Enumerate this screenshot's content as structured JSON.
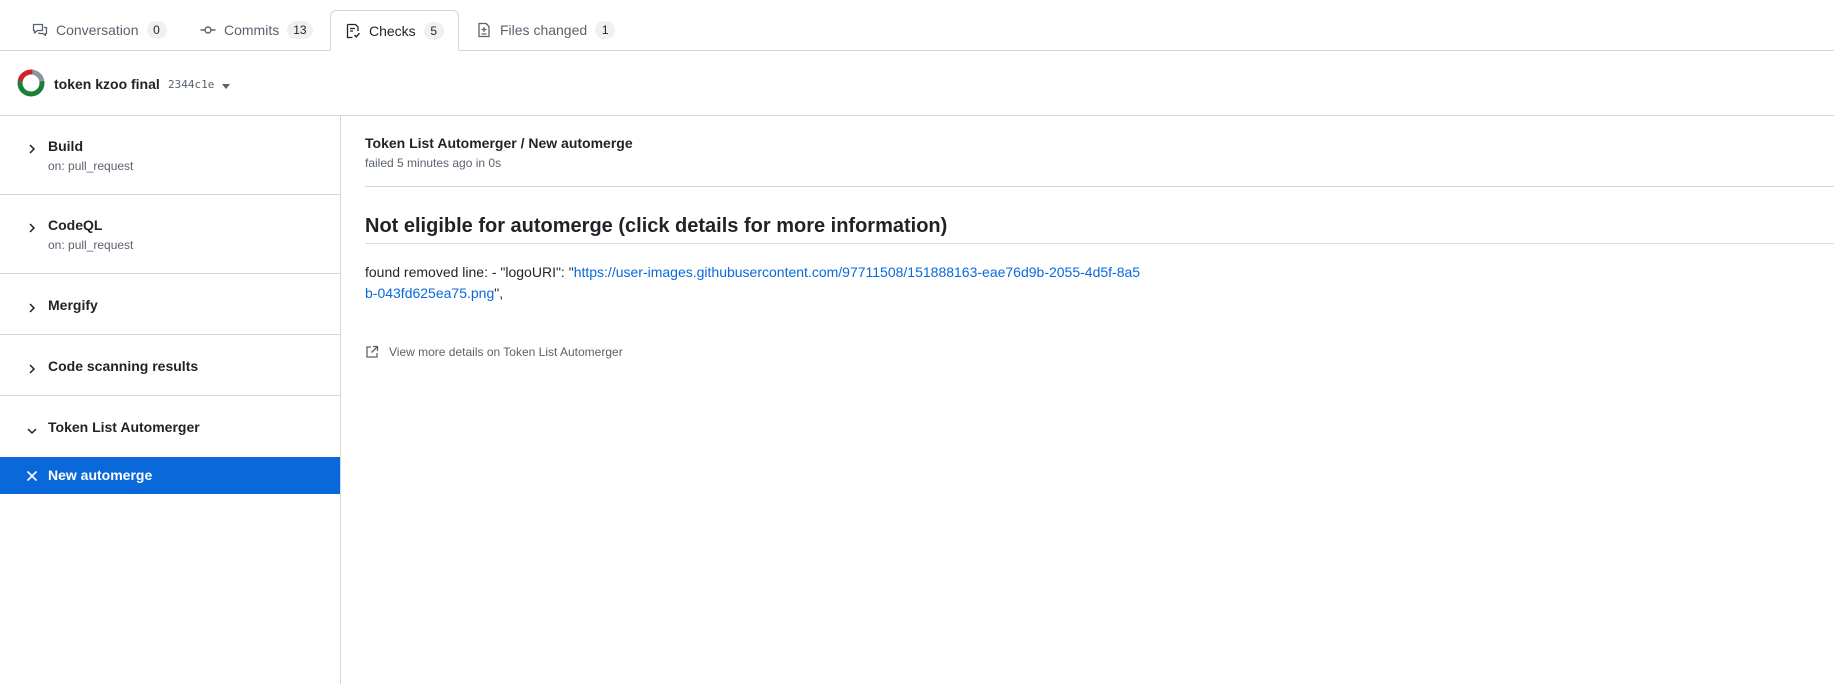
{
  "tabs": [
    {
      "label": "Conversation",
      "count": "0",
      "icon": "comment-discussion-icon"
    },
    {
      "label": "Commits",
      "count": "13",
      "icon": "git-commit-icon"
    },
    {
      "label": "Checks",
      "count": "5",
      "icon": "checklist-icon",
      "active": true
    },
    {
      "label": "Files changed",
      "count": "1",
      "icon": "file-diff-icon"
    }
  ],
  "commit": {
    "title": "token kzoo final",
    "sha": "2344c1e",
    "status_icon": "check-status-ring-icon",
    "ring_colors": {
      "success": "#1a7f37",
      "failure": "#cf222e",
      "neutral": "#8c959f"
    }
  },
  "sidebar": {
    "workflows": [
      {
        "name": "Build",
        "trigger": "on: pull_request",
        "expanded": false
      },
      {
        "name": "CodeQL",
        "trigger": "on: pull_request",
        "expanded": false
      },
      {
        "name": "Mergify",
        "trigger": "",
        "expanded": false
      },
      {
        "name": "Code scanning results",
        "trigger": "",
        "expanded": false
      },
      {
        "name": "Token List Automerger",
        "trigger": "",
        "expanded": true
      }
    ],
    "active_job": {
      "name": "New automerge",
      "status": "failed",
      "icon": "x-icon"
    }
  },
  "main": {
    "job_title": "Token List Automerger / New automerge",
    "job_meta": "failed 5 minutes ago in 0s",
    "heading": "Not eligible for automerge (click details for more information)",
    "body_prefix": "found removed line: - \"logoURI\": \"",
    "body_link": "https://user-images.githubusercontent.com/97711508/151888163-eae76d9b-2055-4d5f-8a5b-043fd625ea75.png",
    "body_suffix": "\",",
    "details_link": "View more details on Token List Automerger",
    "details_icon": "link-external-icon"
  },
  "colors": {
    "accent": "#0969da",
    "border": "#d0d7de",
    "muted_text": "#59636e"
  }
}
